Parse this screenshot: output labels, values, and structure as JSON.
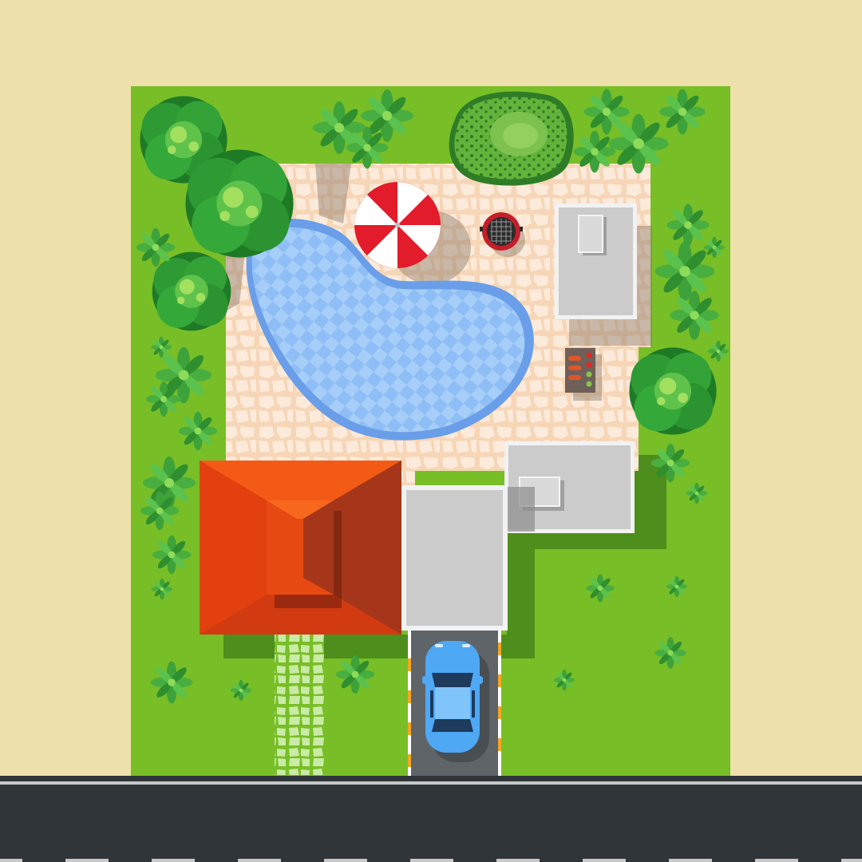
{
  "scene": {
    "view": "top-down",
    "subject": "house-lot",
    "elements": [
      "lawn",
      "patio",
      "pool",
      "beach-umbrella",
      "grill",
      "bbq-skewers",
      "house",
      "garage",
      "outbuilding-north",
      "outbuilding-east",
      "driveway",
      "car",
      "stone-path",
      "trees",
      "bushes",
      "hedge",
      "road"
    ]
  },
  "colors": {
    "ground": "#EEE0AA",
    "lawn": "#78BE27",
    "lawn_shadow": "#4E8E1C",
    "patio": "#F6D6B6",
    "patio_stone": "#FCEADB",
    "pool": "#8EBEF5",
    "pool_rim": "#6A9EE8",
    "roof_main": "#E2410F",
    "roof_light": "#F35A16",
    "roof_dark": "#A53619",
    "building_roof": "#CBCBCB",
    "building_edge": "#F2F2F2",
    "asphalt": "#2F3538",
    "driveway": "#5E6468",
    "car_body": "#4FA8F4",
    "umbrella_red": "#E21C2A",
    "tree_dark": "#2E8E2F",
    "tree_light": "#9BDD4C",
    "hedge": "#63B23A"
  }
}
